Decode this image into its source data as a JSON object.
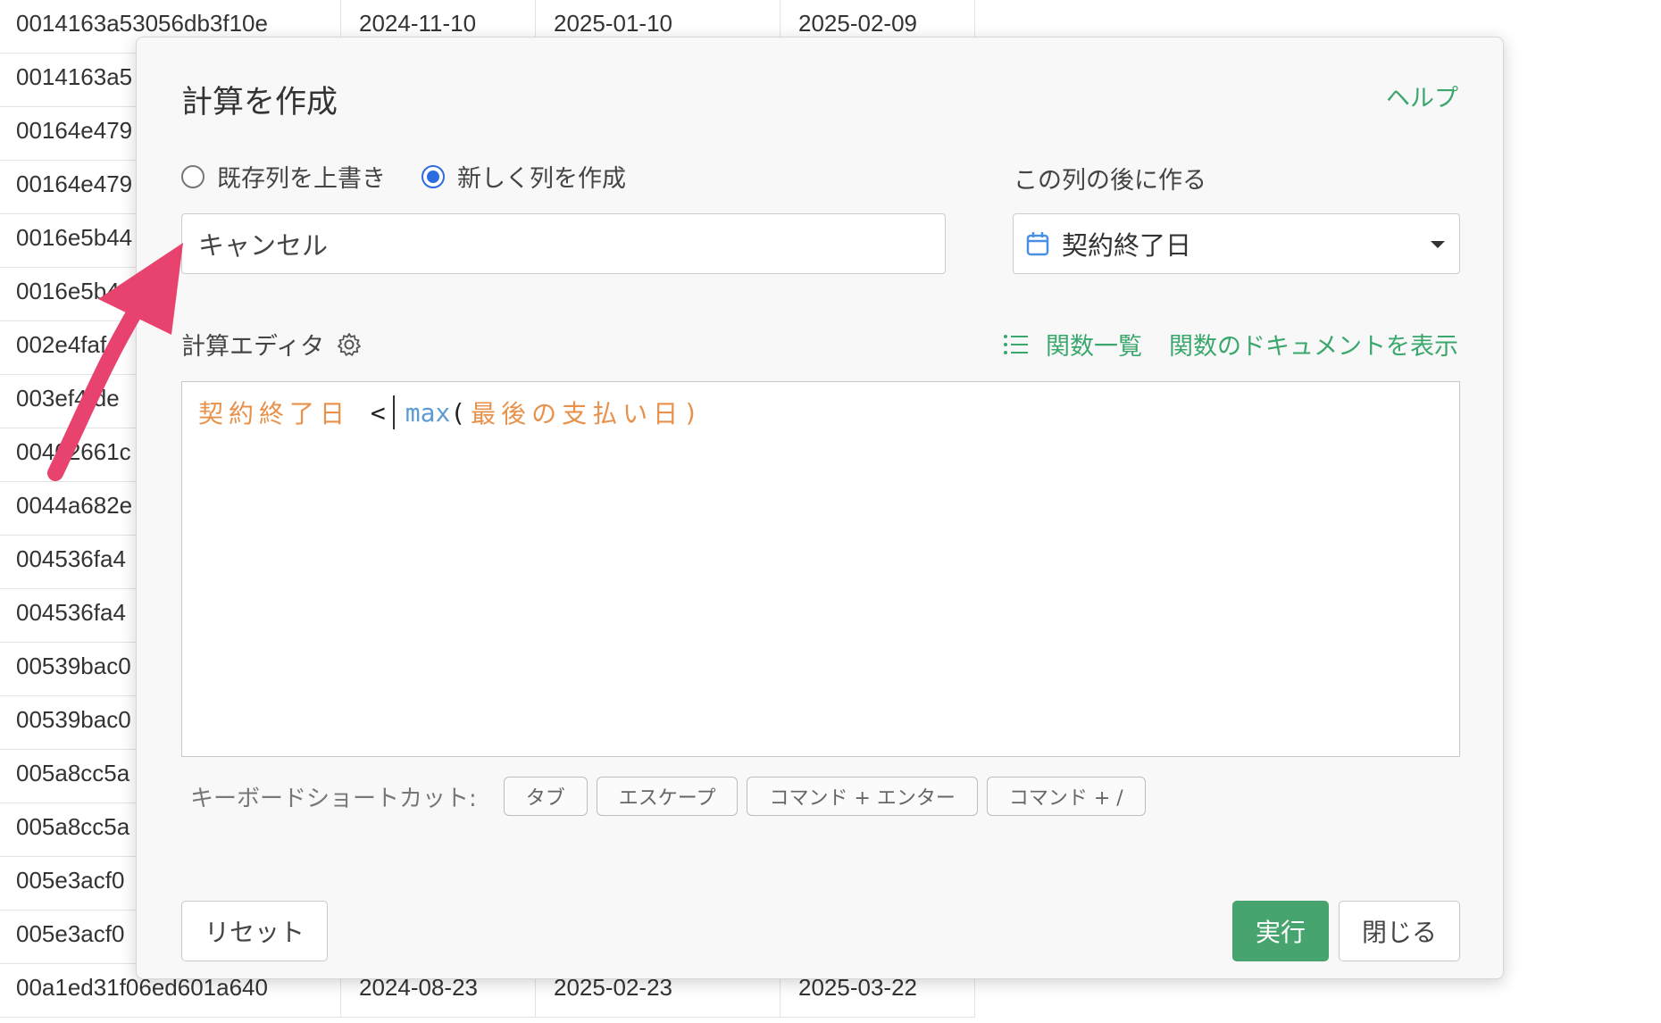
{
  "background_table": {
    "rows": [
      [
        "0014163a53056db3f10e",
        "2024-11-10",
        "2025-01-10",
        "2025-02-09"
      ],
      [
        "0014163a5",
        "",
        "",
        ""
      ],
      [
        "00164e479",
        "",
        "",
        ""
      ],
      [
        "00164e479",
        "",
        "",
        ""
      ],
      [
        "0016e5b44",
        "",
        "",
        ""
      ],
      [
        "0016e5b4",
        "",
        "",
        ""
      ],
      [
        "002e4faf",
        "",
        "",
        ""
      ],
      [
        "003ef4 de",
        "",
        "",
        ""
      ],
      [
        "00402661c",
        "",
        "",
        ""
      ],
      [
        "0044a682e",
        "",
        "",
        ""
      ],
      [
        "004536fa4",
        "",
        "",
        ""
      ],
      [
        "004536fa4",
        "",
        "",
        ""
      ],
      [
        "00539bac0",
        "",
        "",
        ""
      ],
      [
        "00539bac0",
        "",
        "",
        ""
      ],
      [
        "005a8cc5a",
        "",
        "",
        ""
      ],
      [
        "005a8cc5a",
        "",
        "",
        ""
      ],
      [
        "005e3acf0",
        "",
        "",
        ""
      ],
      [
        "005e3acf0",
        "",
        "",
        ""
      ],
      [
        "00a1ed31f06ed601a640",
        "2024-08-23",
        "2025-02-23",
        "2025-03-22"
      ]
    ]
  },
  "dialog": {
    "title": "計算を作成",
    "help_label": "ヘルプ",
    "radio_overwrite_label": "既存列を上書き",
    "radio_new_label": "新しく列を作成",
    "radio_selected": "new",
    "after_column_label": "この列の後に作る",
    "column_name_value": "キャンセル",
    "after_column_value": "契約終了日",
    "editor_label": "計算エディタ",
    "function_list_label": "関数一覧",
    "function_docs_label": "関数のドキュメントを表示",
    "formula": {
      "col1": "契約終了日",
      "op": "<",
      "fn": "max",
      "paren_open": "(",
      "col2": "最後の支払い日",
      "paren_close": ")"
    },
    "shortcut_label": "キーボードショートカット:",
    "shortcuts": [
      "タブ",
      "エスケープ",
      "コマンド + エンター",
      "コマンド + /"
    ],
    "reset_label": "リセット",
    "run_label": "実行",
    "close_label": "閉じる"
  },
  "colors": {
    "accent_green": "#3aa76d",
    "run_button": "#48a46f",
    "radio_blue": "#2d6cdf",
    "column_token": "#e8914a",
    "function_token": "#5b9bd5",
    "annotation_arrow": "#e8436e"
  },
  "icons": [
    "calendar-icon",
    "gear-icon",
    "list-icon",
    "caret-down-icon",
    "annotation-arrow"
  ]
}
